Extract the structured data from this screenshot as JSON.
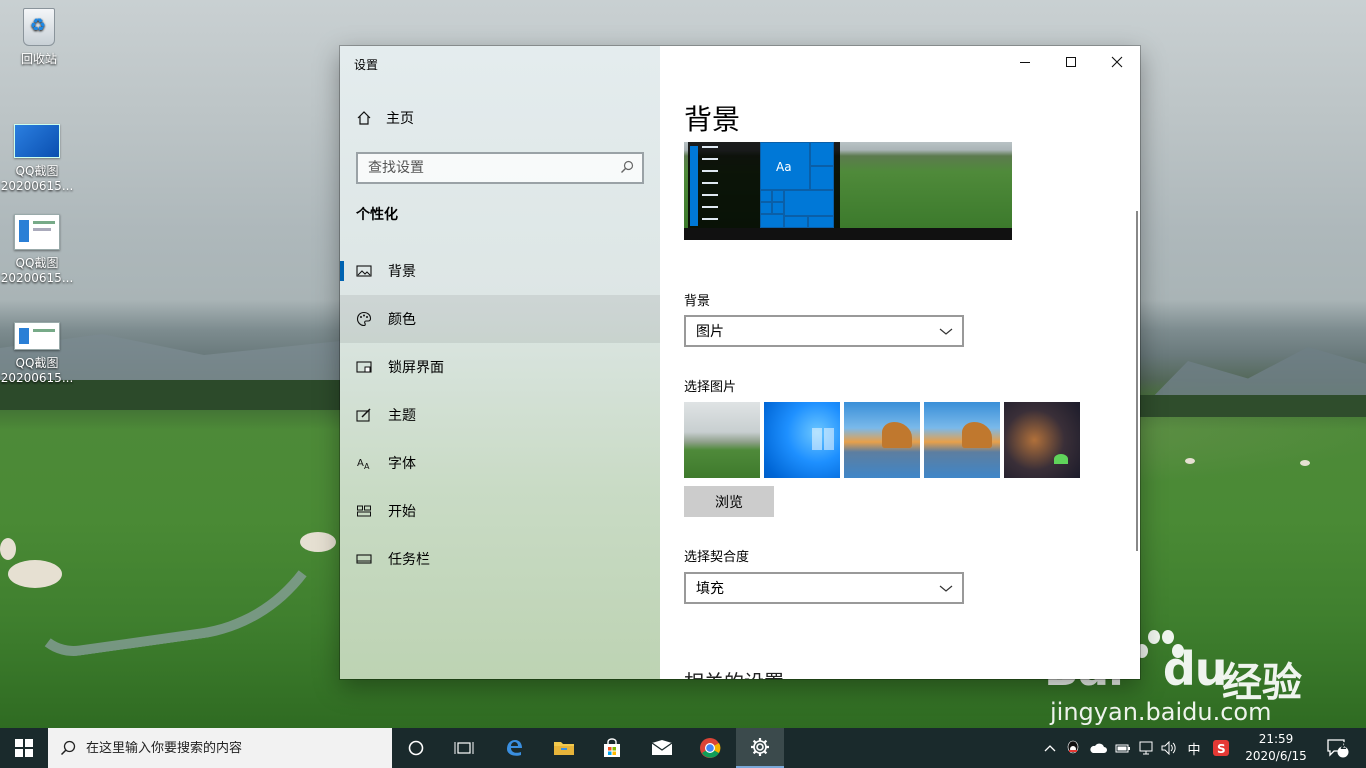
{
  "desktop": {
    "icons": [
      {
        "label": "回收站"
      },
      {
        "label1": "QQ截图",
        "label2": "20200615..."
      },
      {
        "label1": "QQ截图",
        "label2": "20200615..."
      },
      {
        "label1": "QQ截图",
        "label2": "20200615..."
      }
    ]
  },
  "window": {
    "title": "设置",
    "home_label": "主页",
    "search_placeholder": "查找设置",
    "section": "个性化",
    "nav": [
      {
        "label": "背景",
        "icon": "picture-icon",
        "selected": true
      },
      {
        "label": "颜色",
        "icon": "palette-icon"
      },
      {
        "label": "锁屏界面",
        "icon": "lock-screen-icon"
      },
      {
        "label": "主题",
        "icon": "theme-brush-icon"
      },
      {
        "label": "字体",
        "icon": "font-icon"
      },
      {
        "label": "开始",
        "icon": "start-grid-icon"
      },
      {
        "label": "任务栏",
        "icon": "taskbar-icon"
      }
    ],
    "content": {
      "page_title": "背景",
      "preview_tile_text": "Aa",
      "background_label": "背景",
      "background_value": "图片",
      "choose_picture_label": "选择图片",
      "browse_label": "浏览",
      "fit_label": "选择契合度",
      "fit_value": "填充",
      "cutoff_heading": "相关的设置"
    }
  },
  "taskbar": {
    "search_placeholder": "在这里输入你要搜索的内容",
    "ime": "中",
    "time": "21:59",
    "date": "2020/6/15",
    "notification_count": "2"
  },
  "watermark": {
    "logo_left": "Bai",
    "logo_right": "du",
    "cn": "经验",
    "url": "jingyan.baidu.com"
  },
  "colors": {
    "accent": "#0078d7",
    "selection_bar": "#0063b1",
    "taskbar": "#1a2a2c"
  }
}
